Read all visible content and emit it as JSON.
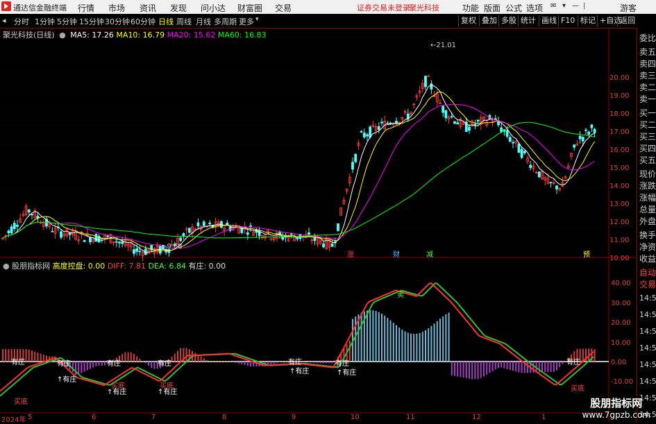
{
  "menubar": {
    "app_title": "通达信金融终端",
    "items": [
      "行情",
      "市场",
      "资讯",
      "发现",
      "问小达",
      "财富圈",
      "交易"
    ],
    "status": "证券交易未登录",
    "stock_name": "聚光科技",
    "right_items": [
      "功能",
      "版面",
      "公式",
      "选项"
    ],
    "guest": "游客"
  },
  "toolbar": {
    "periods": [
      "分时",
      "1分钟",
      "5分钟",
      "15分钟",
      "30分钟",
      "60分钟",
      "日线",
      "周线",
      "月线",
      "多周期",
      "更多"
    ],
    "active_period": "日线",
    "buttons": [
      "复权",
      "叠加",
      "多股",
      "统计",
      "画线",
      "F10",
      "标记",
      "+自选",
      "返回"
    ]
  },
  "main_chart": {
    "title": "聚光科技(日线)",
    "ma5": "MA5: 17.26",
    "ma10": "MA10: 16.79",
    "ma20": "MA20: 15.62",
    "ma60": "MA60: 16.83",
    "high_label": "21.01",
    "low_label": "9.68",
    "y_ticks": [
      "20.00",
      "19.00",
      "18.00",
      "17.00",
      "16.00",
      "15.00",
      "14.00",
      "13.00",
      "12.00",
      "11.00",
      "10.00"
    ],
    "event_tags": [
      "涨",
      "财",
      "减",
      "预"
    ]
  },
  "indicator": {
    "title": "股朋指标网",
    "gdkp": "高度控盘: 0.00",
    "diff": "DIFF: 7.81",
    "dea": "DEA: 6.84",
    "youzhuang": "有庄: 0.00",
    "y_ticks": [
      "40.00",
      "30.00",
      "20.00",
      "10.00",
      "0.00",
      "-10.00"
    ],
    "labels_top": [
      "有庄",
      "有庄",
      "有庄",
      "有庄",
      "有庄",
      "有庄",
      "有庄"
    ],
    "labels_bottom": [
      "有庄",
      "有庄",
      "有庄",
      "有庄",
      "有庄"
    ],
    "buy_labels": [
      "买底",
      "买底",
      "买底",
      "买底"
    ],
    "sell_label": "卖"
  },
  "x_axis": {
    "labels": [
      "2024年",
      "5",
      "6",
      "7",
      "8",
      "9",
      "10",
      "11",
      "12",
      "1"
    ]
  },
  "right_panel": [
    "委比",
    "卖五",
    "卖四",
    "卖三",
    "卖二",
    "卖一",
    "买一",
    "买二",
    "买三",
    "买四",
    "买五",
    "现价",
    "涨跌",
    "涨幅",
    "总量",
    "外盘",
    "换手",
    "净资",
    "收益",
    "自动",
    "交易"
  ],
  "right_axis2": [
    "14:56",
    "14:56",
    "14:56",
    "14:56",
    "14:56",
    "14:56",
    "14:56",
    "14:56"
  ],
  "watermark": {
    "line1": "股朋指标网",
    "line2": "www.7gpzb.com"
  },
  "colors": {
    "up": "#ff3b3b",
    "down": "#54fcfc",
    "ma5": "#ffffff",
    "ma10": "#ffff00",
    "ma20": "#ff00ff",
    "ma60": "#00ff00"
  }
}
